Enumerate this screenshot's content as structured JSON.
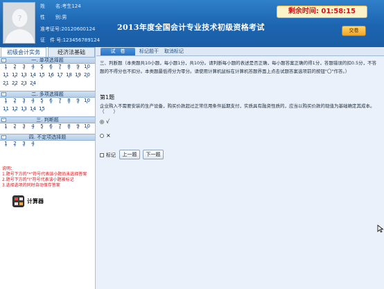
{
  "header": {
    "info": [
      {
        "key": "姓",
        "value": "名:考生124"
      },
      {
        "key": "性",
        "value": "别:男"
      },
      {
        "key": "准考证号:",
        "value": "20120600124"
      },
      {
        "key": "证　件 号:",
        "value": "123456789124"
      }
    ],
    "title": "2013年度全国会计专业技术初级资格考试",
    "timer": "剩余时间: 01:58:15",
    "submit_label": "交卷"
  },
  "sidebar": {
    "tabs": [
      "初级会计实务",
      "经济法基础"
    ],
    "sections": [
      {
        "label": "一. 单项选择题",
        "numbers": [
          "1",
          "2",
          "3",
          "4",
          "5",
          "6",
          "7",
          "8",
          "9",
          "10",
          "11",
          "12",
          "13",
          "14",
          "15",
          "16",
          "17",
          "18",
          "19",
          "20",
          "21",
          "22",
          "23",
          "24"
        ]
      },
      {
        "label": "二. 多项选择题",
        "numbers": [
          "1",
          "2",
          "3",
          "4",
          "5",
          "6",
          "7",
          "8",
          "9",
          "10",
          "11",
          "12",
          "13",
          "14",
          "15"
        ]
      },
      {
        "label": "三. 判断题",
        "numbers": [
          "1",
          "2",
          "3",
          "4",
          "5",
          "6",
          "7",
          "8",
          "9",
          "10"
        ]
      },
      {
        "label": "四. 不定项选择题",
        "numbers": [
          "1",
          "2",
          "3",
          "4"
        ]
      }
    ],
    "notes": [
      "说明：",
      "1.题号下方的\"*\"符号代表该小题尚未选择答案",
      "2.题号下方的\"!\"符号代表该小题被标记",
      "3.选择选项的同时自动保存答案"
    ],
    "calc_label": "计算器"
  },
  "main": {
    "tabs": [
      "试　卷",
      "标记题干",
      "取消标记"
    ],
    "section_desc": "三、判断题（本类题共10小题，每小题1分，共10分。请判断每小题的表述是否正确，每小题答案正确的得1分，答题错误的扣0.5分，不答题的不得分也不扣分。本类题最低得分为零分。请使用计算机鼠标在计算机答题界面上点击试题答案选项前的按钮\"〇\"作答。）",
    "question_title": "第1题",
    "question_body": "企业购入不需要安装的生产设备，购买价款超过正常信用条件延期支付，实质具有融资性质的，应当以购买价款的现值为基础确定其成本。（　　）",
    "options": [
      {
        "label": "√",
        "selected": true
      },
      {
        "label": "×",
        "selected": false
      }
    ],
    "mark_label": "标记",
    "prev_label": "上一题",
    "next_label": "下一题"
  }
}
